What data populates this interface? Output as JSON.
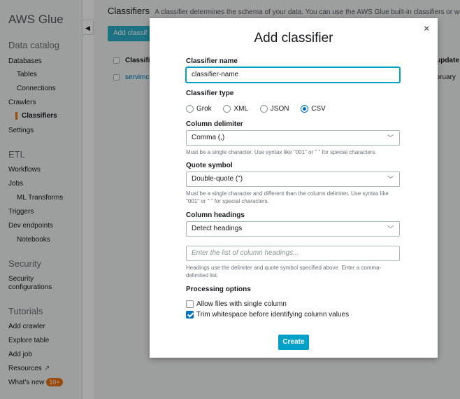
{
  "sidebar": {
    "brand": "AWS Glue",
    "sections": {
      "data_catalog": "Data catalog",
      "etl": "ETL",
      "security": "Security",
      "tutorials": "Tutorials"
    },
    "items": {
      "databases": "Databases",
      "tables": "Tables",
      "connections": "Connections",
      "crawlers": "Crawlers",
      "classifiers": "Classifiers",
      "settings": "Settings",
      "workflows": "Workflows",
      "jobs": "Jobs",
      "ml_transforms": "ML Transforms",
      "triggers": "Triggers",
      "dev_endpoints": "Dev endpoints",
      "notebooks": "Notebooks",
      "security_configurations": "Security configurations",
      "add_crawler": "Add crawler",
      "explore_table": "Explore table",
      "add_job": "Add job",
      "resources": "Resources",
      "whats_new": "What's new"
    },
    "whats_new_badge": "10+",
    "collapse_icon": "caret-left-icon",
    "resources_icon": "external-link-icon"
  },
  "main": {
    "title": "Classifiers",
    "description": "A classifier determines the schema of your data. You can use the AWS Glue built-in classifiers or write",
    "add_button": "Add classif",
    "table": {
      "col_name": "Classifi",
      "col_updated": "t update",
      "row_name": "servimc",
      "row_updated": "ebruary"
    }
  },
  "modal": {
    "title": "Add classifier",
    "close": "×",
    "classifier_name_label": "Classifier name",
    "classifier_name_value": "classifier-name",
    "classifier_type_label": "Classifier type",
    "types": [
      "Grok",
      "XML",
      "JSON",
      "CSV"
    ],
    "selected_type": "CSV",
    "column_delimiter_label": "Column delimiter",
    "column_delimiter_value": "Comma (,)",
    "column_delimiter_hint": "Must be a single character. Use syntax like \"001\" or \" \" for special characters.",
    "quote_symbol_label": "Quote symbol",
    "quote_symbol_value": "Double-quote (\")",
    "quote_symbol_hint": "Must be a single character and different than the column delimiter. Use syntax like \"001\" or \" \" for special characters.",
    "column_headings_label": "Column headings",
    "column_headings_value": "Detect headings",
    "headings_placeholder": "Enter the list of column headings...",
    "headings_hint": "Headings use the delimiter and quote symbol specified above. Enter a comma-delimited list.",
    "processing_label": "Processing options",
    "opt_single_column": "Allow files with single column",
    "opt_trim": "Trim whitespace before identifying column values",
    "opt_single_column_checked": false,
    "opt_trim_checked": true,
    "create_button": "Create"
  },
  "colors": {
    "accent": "#ec7211",
    "link": "#0073bb",
    "primary_button": "#00a1c9"
  }
}
